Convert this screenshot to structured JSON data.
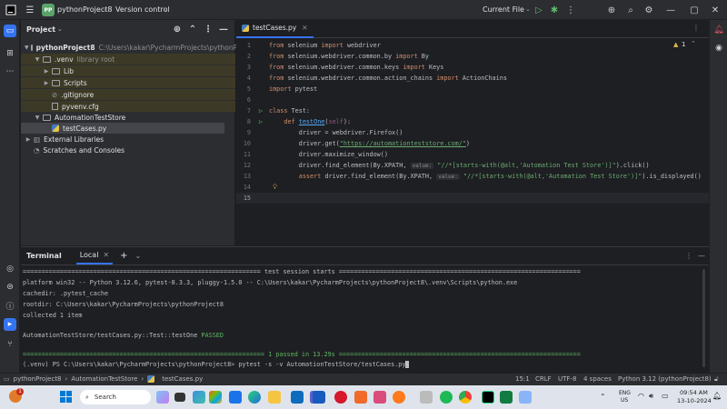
{
  "titlebar": {
    "project_badge": "PP",
    "project_name": "pythonProject8",
    "vcs": "Version control",
    "run_config": "Current File"
  },
  "project_pane": {
    "title": "Project",
    "root_name": "pythonProject8",
    "root_path": "C:\\Users\\kakar\\PycharmProjects\\pythonProject8",
    "venv": ".venv",
    "venv_note": "library root",
    "lib": "Lib",
    "scripts": "Scripts",
    "gitignore": ".gitignore",
    "pyvenv": "pyvenv.cfg",
    "folder": "AutomationTestStore",
    "file": "testCases.py",
    "ext_libs": "External Libraries",
    "scratches": "Scratches and Consoles"
  },
  "editor": {
    "tab": "testCases.py",
    "warning_count": "1",
    "lines": [
      "1",
      "2",
      "3",
      "4",
      "5",
      "6",
      "7",
      "8",
      "9",
      "10",
      "11",
      "12",
      "13",
      "14",
      "15"
    ],
    "code": {
      "l1a": "from",
      "l1b": " selenium ",
      "l1c": "import",
      "l1d": " webdriver",
      "l2a": "from",
      "l2b": " selenium.webdriver.common.by ",
      "l2c": "import",
      "l2d": " By",
      "l3a": "from",
      "l3b": " selenium.webdriver.common.keys ",
      "l3c": "import",
      "l3d": " Keys",
      "l4a": "from",
      "l4b": " selenium.webdriver.common.action_chains ",
      "l4c": "import",
      "l4d": " ActionChains",
      "l5a": "import",
      "l5b": " pytest",
      "l7a": "class",
      "l7b": " Test:",
      "l8a": "    def ",
      "l8b": "testOne",
      "l8c": "(",
      "l8d": "self",
      "l8e": "):",
      "l9": "        driver = webdriver.Firefox()",
      "l10a": "        driver.get(",
      "l10b": "\"https://automationteststore.com/\"",
      "l10c": ")",
      "l11": "        driver.maximize_window()",
      "l12a": "        driver.find_element(By.XPATH, ",
      "l12h": "value:",
      "l12b": " \"//*[starts-with(@alt,'Automation Test Store')]\"",
      "l12c": ").click()",
      "l13a": "        assert",
      "l13b": " driver.find_element(By.XPATH, ",
      "l13h": "value:",
      "l13c": " \"//*[starts-with(@alt,'Automation Test Store')]\"",
      "l13d": ").is_displayed()"
    }
  },
  "terminal": {
    "title": "Terminal",
    "tab": "Local",
    "l1": "================================================================ test session starts =================================================================",
    "l2": "platform win32 -- Python 3.12.6, pytest-8.3.3, pluggy-1.5.0 -- C:\\Users\\kakar\\PycharmProjects\\pythonProject8\\.venv\\Scripts\\python.exe",
    "l3": "cachedir: .pytest_cache",
    "l4": "rootdir: C:\\Users\\kakar\\PycharmProjects\\pythonProject8",
    "l5": "collected 1 item",
    "l6a": "AutomationTestStore/testCases.py::Test::testOne ",
    "l6b": "PASSED",
    "l7": "================================================================= 1 passed in 13.29s =================================================================",
    "l8": "(.venv) PS C:\\Users\\kakar\\PycharmProjects\\pythonProject8> pytest -s -v AutomationTestStore/testCases.py"
  },
  "statusbar": {
    "crumb1": "pythonProject8",
    "crumb2": "AutomationTestStore",
    "crumb3": "testCases.py",
    "pos": "15:1",
    "eol": "CRLF",
    "enc": "UTF-8",
    "indent": "4 spaces",
    "interp": "Python 3.12 (pythonProject8)"
  },
  "taskbar": {
    "search": "Search",
    "lang1": "ENG",
    "lang2": "US",
    "time": "09:54 AM",
    "date": "13-10-2024",
    "notif": "1"
  },
  "colors": {
    "accent": "#3574f0",
    "passed": "#5fb865",
    "string": "#6aab73",
    "keyword": "#cf8e6d"
  }
}
